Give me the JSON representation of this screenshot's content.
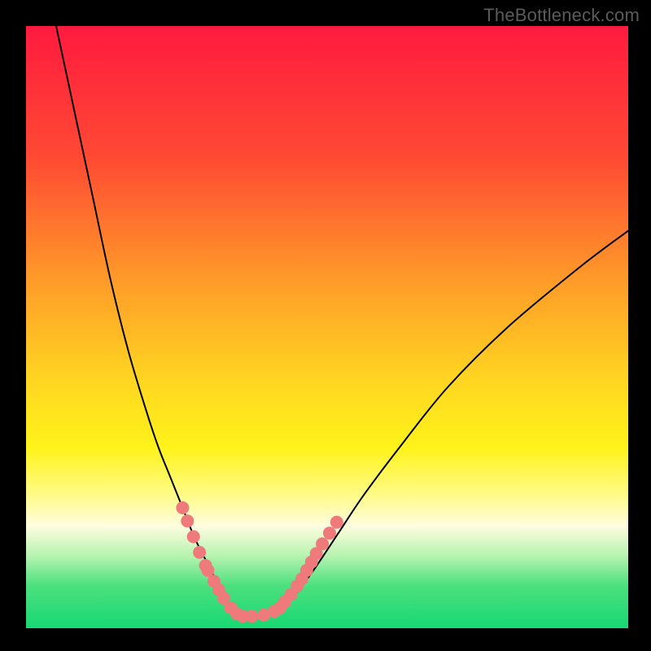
{
  "watermark": "TheBottleneck.com",
  "chart_data": {
    "type": "line",
    "title": "",
    "xlabel": "",
    "ylabel": "",
    "xlim": [
      0,
      100
    ],
    "ylim": [
      0,
      100
    ],
    "grid": false,
    "legend": false,
    "gradient_stops": [
      {
        "offset": 0.0,
        "color": "#ff1a3f"
      },
      {
        "offset": 0.22,
        "color": "#ff4a33"
      },
      {
        "offset": 0.42,
        "color": "#ff9a29"
      },
      {
        "offset": 0.58,
        "color": "#ffd321"
      },
      {
        "offset": 0.7,
        "color": "#fff31a"
      },
      {
        "offset": 0.78,
        "color": "#fffb8a"
      },
      {
        "offset": 0.83,
        "color": "#fffde0"
      },
      {
        "offset": 0.88,
        "color": "#b6f3b0"
      },
      {
        "offset": 0.93,
        "color": "#4be07e"
      },
      {
        "offset": 1.0,
        "color": "#17d873"
      }
    ],
    "series": [
      {
        "name": "bottleneck-curve",
        "stroke": "#000000",
        "stroke_width": 2,
        "x": [
          5,
          8,
          11,
          14,
          17,
          20,
          22,
          24,
          26,
          28,
          30,
          31,
          32,
          33,
          34,
          35,
          36,
          38,
          40,
          42,
          45,
          48,
          52,
          56,
          62,
          70,
          80,
          92,
          100
        ],
        "y": [
          100,
          86,
          72,
          58,
          46,
          36,
          30,
          25,
          20,
          15,
          11,
          9,
          7,
          5,
          3,
          2,
          2,
          2,
          2,
          3,
          6,
          10,
          16,
          22,
          30,
          40,
          50,
          60,
          66
        ]
      },
      {
        "name": "segment-markers",
        "type": "scatter",
        "fill": "#ee7a7c",
        "radius": 8,
        "x": [
          26.0,
          26.8,
          27.8,
          28.8,
          29.8,
          30.2,
          31.2,
          32.0,
          32.8,
          34.0,
          35.0,
          36.0,
          37.5,
          39.5,
          41.2,
          42.2,
          43.0,
          44.0,
          45.0,
          45.8,
          46.6,
          47.4,
          48.2,
          49.2,
          50.4,
          51.6
        ],
        "y": [
          20.0,
          17.8,
          15.2,
          12.6,
          10.4,
          9.6,
          7.8,
          6.4,
          5.0,
          3.4,
          2.4,
          2.0,
          2.0,
          2.2,
          2.8,
          3.4,
          4.4,
          5.6,
          7.0,
          8.2,
          9.6,
          11.0,
          12.4,
          14.0,
          15.8,
          17.6
        ]
      }
    ]
  }
}
